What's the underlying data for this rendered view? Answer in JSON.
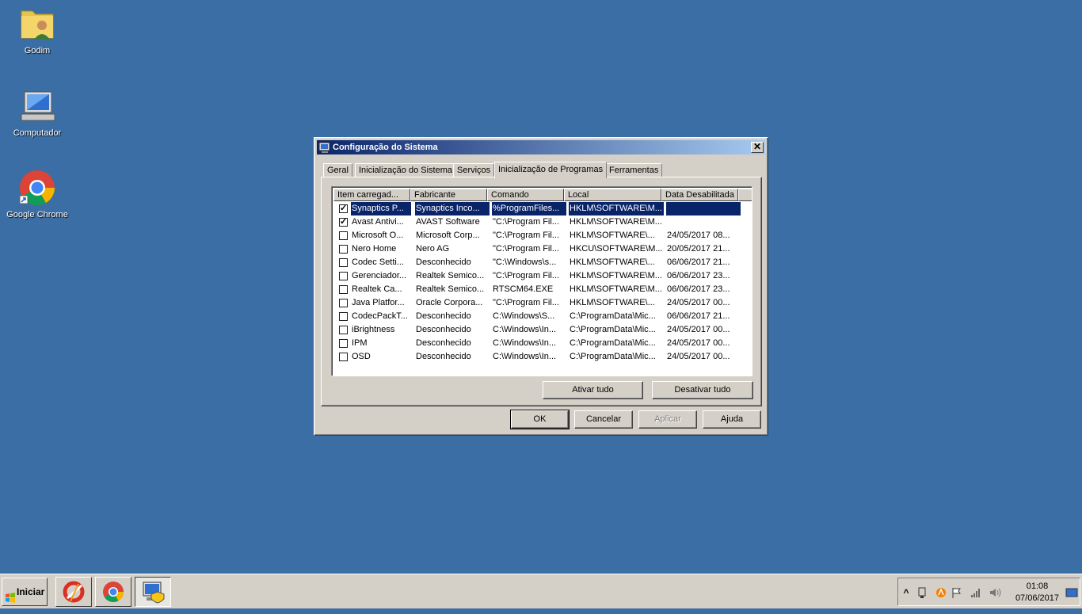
{
  "desktop": {
    "icons": [
      {
        "label": "Godim",
        "icon": "user-folder-icon"
      },
      {
        "label": "Computador",
        "icon": "computer-icon"
      },
      {
        "label": "Google Chrome",
        "icon": "chrome-icon"
      }
    ]
  },
  "dialog": {
    "title": "Configuração do Sistema",
    "close_glyph": "✕",
    "tabs": [
      {
        "label": "Geral"
      },
      {
        "label": "Inicialização do Sistema"
      },
      {
        "label": "Serviços"
      },
      {
        "label": "Inicialização de Programas",
        "active": true
      },
      {
        "label": "Ferramentas"
      }
    ],
    "columns": [
      "Item carregad...",
      "Fabricante",
      "Comando",
      "Local",
      "Data Desabilitada"
    ],
    "rows": [
      {
        "checked": true,
        "item": "Synaptics P...",
        "maker": "Synaptics Inco...",
        "command": "%ProgramFiles...",
        "location": "HKLM\\SOFTWARE\\M...",
        "date": ""
      },
      {
        "checked": true,
        "item": "Avast Antivi...",
        "maker": "AVAST Software",
        "command": "\"C:\\Program Fil...",
        "location": "HKLM\\SOFTWARE\\M...",
        "date": ""
      },
      {
        "checked": false,
        "item": "Microsoft O...",
        "maker": "Microsoft Corp...",
        "command": "\"C:\\Program Fil...",
        "location": "HKLM\\SOFTWARE\\...",
        "date": "24/05/2017 08..."
      },
      {
        "checked": false,
        "item": "Nero Home",
        "maker": "Nero AG",
        "command": "\"C:\\Program Fil...",
        "location": "HKCU\\SOFTWARE\\M...",
        "date": "20/05/2017 21..."
      },
      {
        "checked": false,
        "item": "Codec Setti...",
        "maker": "Desconhecido",
        "command": "\"C:\\Windows\\s...",
        "location": "HKLM\\SOFTWARE\\...",
        "date": "06/06/2017 21..."
      },
      {
        "checked": false,
        "item": "Gerenciador...",
        "maker": "Realtek Semico...",
        "command": "\"C:\\Program Fil...",
        "location": "HKLM\\SOFTWARE\\M...",
        "date": "06/06/2017 23..."
      },
      {
        "checked": false,
        "item": "Realtek Ca...",
        "maker": "Realtek Semico...",
        "command": "RTSCM64.EXE",
        "location": "HKLM\\SOFTWARE\\M...",
        "date": "06/06/2017 23..."
      },
      {
        "checked": false,
        "item": "Java Platfor...",
        "maker": "Oracle Corpora...",
        "command": "\"C:\\Program Fil...",
        "location": "HKLM\\SOFTWARE\\...",
        "date": "24/05/2017 00..."
      },
      {
        "checked": false,
        "item": "CodecPackT...",
        "maker": "Desconhecido",
        "command": "C:\\Windows\\S...",
        "location": "C:\\ProgramData\\Mic...",
        "date": "06/06/2017 21..."
      },
      {
        "checked": false,
        "item": "iBrightness",
        "maker": "Desconhecido",
        "command": "C:\\Windows\\In...",
        "location": "C:\\ProgramData\\Mic...",
        "date": "24/05/2017 00..."
      },
      {
        "checked": false,
        "item": "IPM",
        "maker": "Desconhecido",
        "command": "C:\\Windows\\In...",
        "location": "C:\\ProgramData\\Mic...",
        "date": "24/05/2017 00..."
      },
      {
        "checked": false,
        "item": "OSD",
        "maker": "Desconhecido",
        "command": "C:\\Windows\\In...",
        "location": "C:\\ProgramData\\Mic...",
        "date": "24/05/2017 00..."
      }
    ],
    "enable_all_label": "Ativar tudo",
    "disable_all_label": "Desativar tudo",
    "ok_label": "OK",
    "cancel_label": "Cancelar",
    "apply_label": "Aplicar",
    "help_label": "Ajuda"
  },
  "taskbar": {
    "start_label": "Iniciar",
    "apps": [
      "ccleaner-icon",
      "chrome-icon",
      "msconfig-icon"
    ],
    "tray": {
      "expand_glyph": "^",
      "time": "01:08",
      "date": "07/06/2017"
    }
  }
}
